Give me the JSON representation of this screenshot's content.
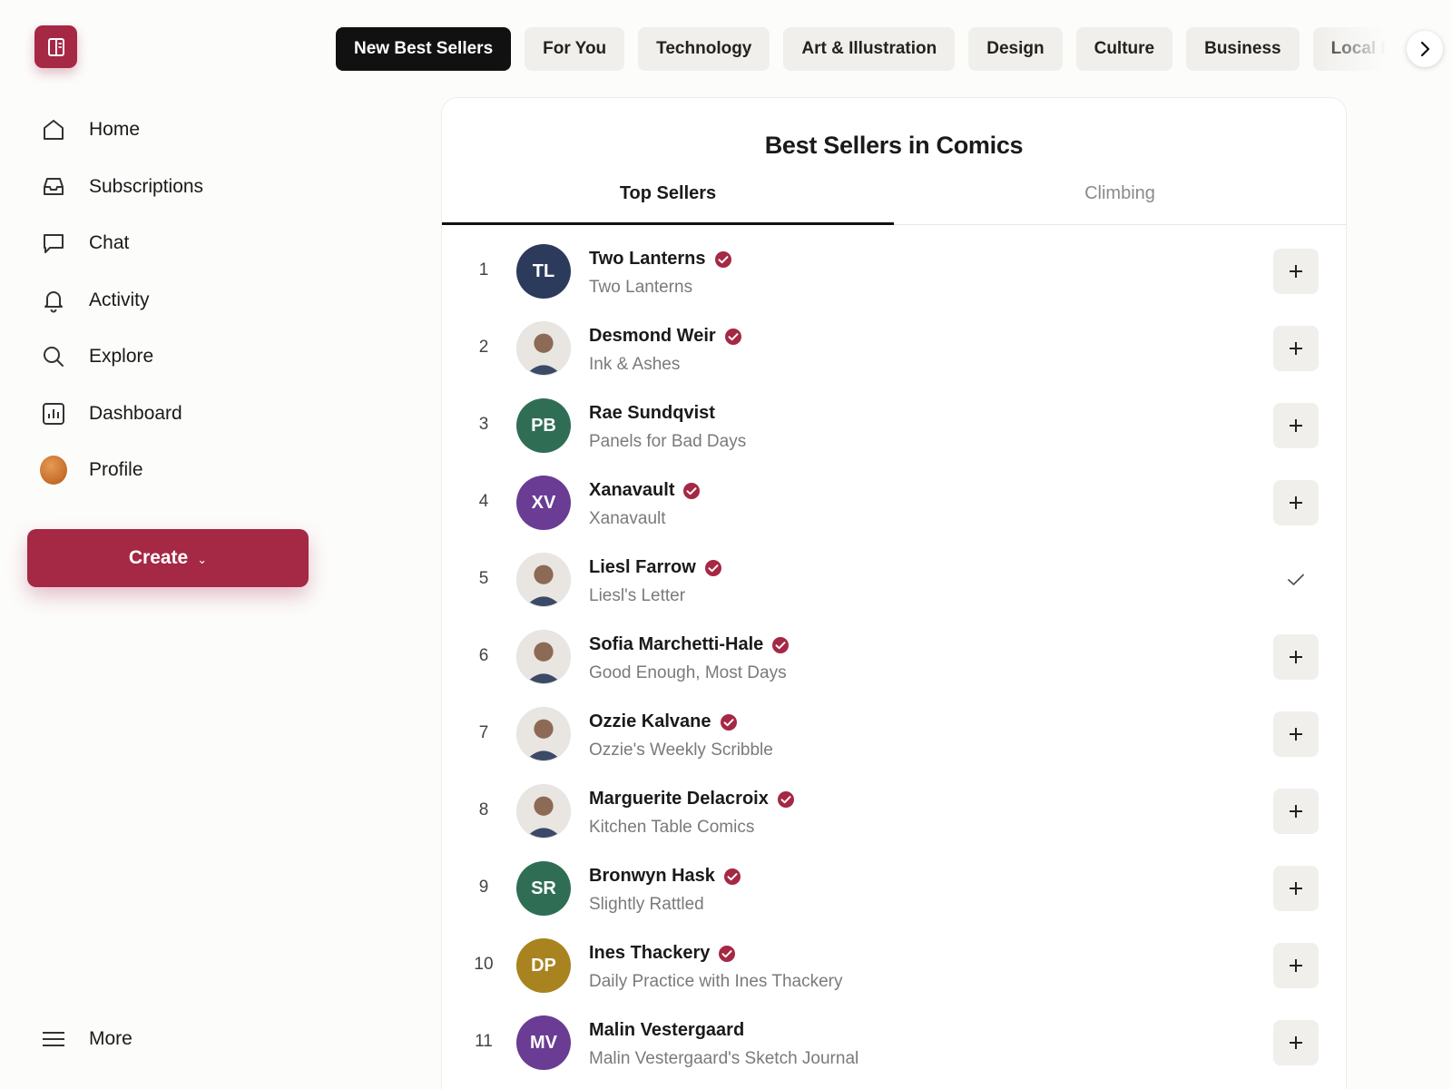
{
  "brand": {
    "accent": "#a52844",
    "icon": "book-icon"
  },
  "nav": {
    "items": [
      {
        "label": "Home",
        "icon": "home-icon"
      },
      {
        "label": "Subscriptions",
        "icon": "inbox-icon"
      },
      {
        "label": "Chat",
        "icon": "chat-icon"
      },
      {
        "label": "Activity",
        "icon": "bell-icon"
      },
      {
        "label": "Explore",
        "icon": "search-icon"
      },
      {
        "label": "Dashboard",
        "icon": "chart-icon"
      },
      {
        "label": "Profile",
        "icon": "avatar"
      }
    ],
    "create_label": "Create",
    "more_label": "More"
  },
  "categories": [
    "New Best Sellers",
    "For You",
    "Technology",
    "Art & Illustration",
    "Design",
    "Culture",
    "Business",
    "Local Policy"
  ],
  "active_category": "New Best Sellers",
  "panel": {
    "title": "Best Sellers in Comics",
    "tabs": [
      "Top Sellers",
      "Climbing"
    ],
    "active_tab": "Top Sellers"
  },
  "rows": [
    {
      "rank": "1",
      "name": "Two Lanterns",
      "pub": "Two Lanterns",
      "initials": "TL",
      "color": "#2c3a5c",
      "verified": true,
      "subscribed": false
    },
    {
      "rank": "2",
      "name": "Desmond Weir",
      "pub": "Ink & Ashes",
      "initials": "",
      "photo": true,
      "verified": true,
      "subscribed": false
    },
    {
      "rank": "3",
      "name": "Rae Sundqvist",
      "pub": "Panels for Bad Days",
      "initials": "PB",
      "color": "#2f6e55",
      "verified": false,
      "subscribed": false
    },
    {
      "rank": "4",
      "name": "Xanavault",
      "pub": "Xanavault",
      "initials": "XV",
      "color": "#6a3c94",
      "verified": true,
      "subscribed": false
    },
    {
      "rank": "5",
      "name": "Liesl Farrow",
      "pub": "Liesl's Letter",
      "initials": "",
      "photo": true,
      "verified": true,
      "subscribed": true
    },
    {
      "rank": "6",
      "name": "Sofia Marchetti-Hale",
      "pub": "Good Enough, Most Days",
      "initials": "",
      "photo": true,
      "verified": true,
      "subscribed": false
    },
    {
      "rank": "7",
      "name": "Ozzie Kalvane",
      "pub": "Ozzie's Weekly Scribble",
      "initials": "",
      "photo": true,
      "verified": true,
      "subscribed": false
    },
    {
      "rank": "8",
      "name": "Marguerite Delacroix",
      "pub": "Kitchen Table Comics",
      "initials": "",
      "photo": true,
      "verified": true,
      "subscribed": false
    },
    {
      "rank": "9",
      "name": "Bronwyn Hask",
      "pub": "Slightly Rattled",
      "initials": "SR",
      "color": "#2f6e55",
      "verified": true,
      "subscribed": false
    },
    {
      "rank": "10",
      "name": "Ines Thackery",
      "pub": "Daily Practice with Ines Thackery",
      "initials": "DP",
      "color": "#a8831f",
      "verified": true,
      "subscribed": false
    },
    {
      "rank": "11",
      "name": "Malin Vestergaard",
      "pub": "Malin Vestergaard's Sketch Journal",
      "initials": "MV",
      "color": "#6a3c94",
      "verified": false,
      "subscribed": false
    }
  ]
}
